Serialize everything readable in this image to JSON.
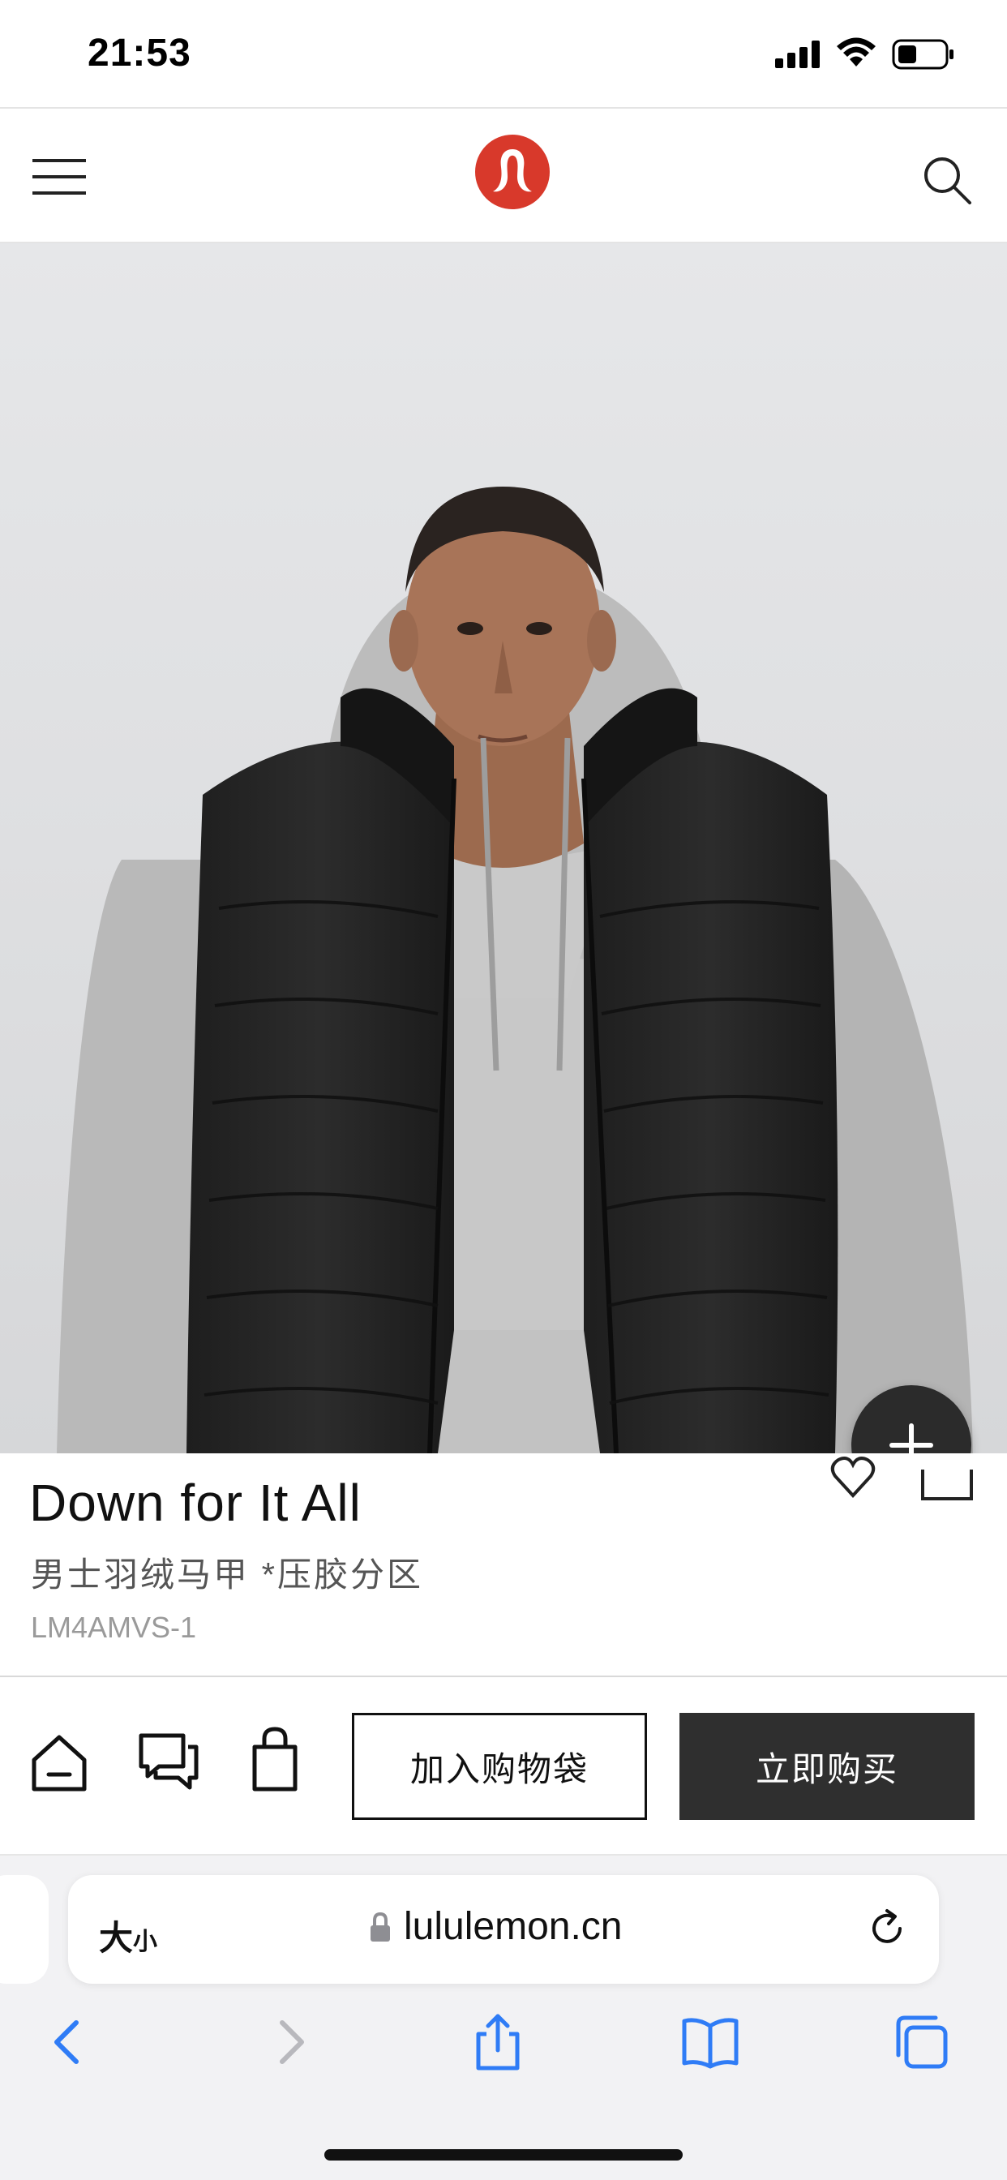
{
  "status_bar": {
    "time": "21:53",
    "icons": [
      "signal-icon",
      "wifi-icon",
      "battery-icon"
    ]
  },
  "header": {
    "icons": [
      "menu-icon",
      "lululemon-logo",
      "search-icon"
    ],
    "brand_color": "#d8392b"
  },
  "product": {
    "title": "Down for It All",
    "subtitle": "男士羽绒马甲 *压胶分区",
    "sku": "LM4AMVS-1",
    "icons": [
      "heart-icon",
      "share-icon",
      "plus-icon"
    ]
  },
  "actions": {
    "icons": [
      "home-icon",
      "chat-icon",
      "bag-icon"
    ],
    "add_to_bag_label": "加入购物袋",
    "buy_now_label": "立即购买"
  },
  "browser": {
    "text_size_label_big": "大",
    "text_size_label_small": "小",
    "url": "lululemon.cn",
    "icons": [
      "lock-icon",
      "reload-icon",
      "back-icon",
      "forward-icon",
      "share-icon",
      "bookmarks-icon",
      "tabs-icon"
    ]
  },
  "colors": {
    "buy_button": "#2f2f2f",
    "safari_blue": "#2f7cf6",
    "hero_bg": "#e3e4e6"
  }
}
